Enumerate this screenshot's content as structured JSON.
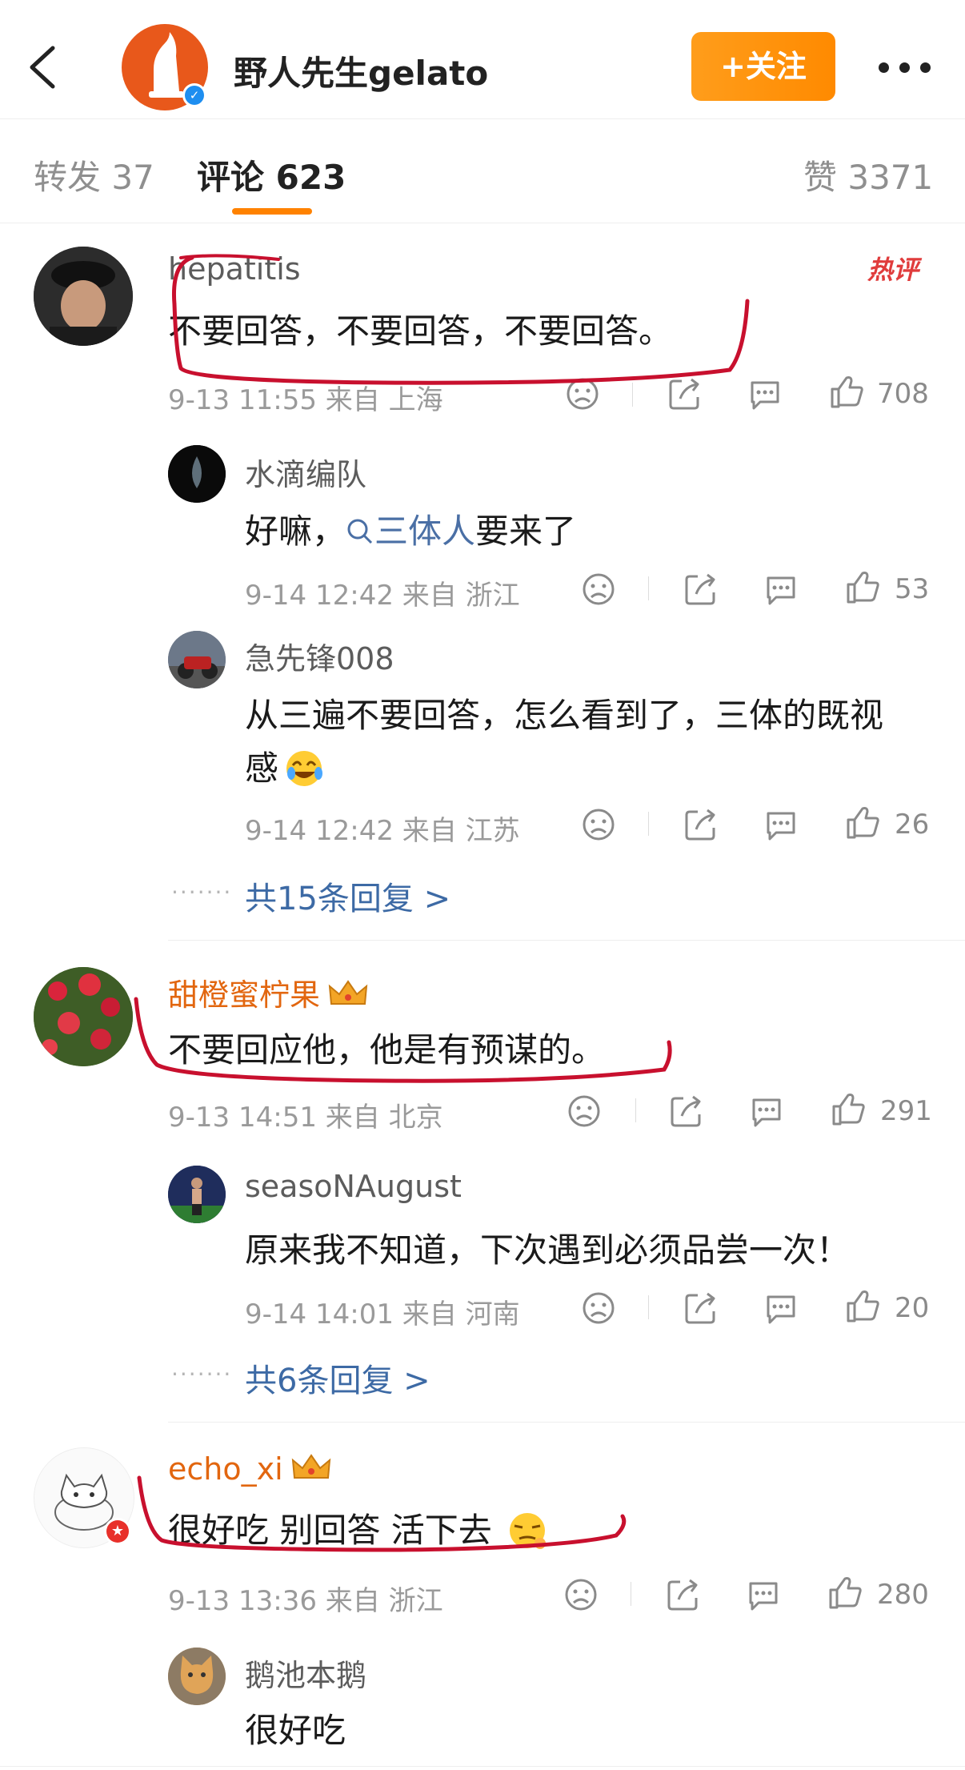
{
  "header": {
    "account_name": "野人先生gelato",
    "follow_label": "+关注"
  },
  "tabs": {
    "repost": "转发 37",
    "comments": "评论 623",
    "likes": "赞 3371"
  },
  "comments": [
    {
      "user": "hepatitis",
      "badge": "热评",
      "text": "不要回答，不要回答，不要回答。",
      "meta": "9-13 11:55 来自 上海",
      "likes": "708",
      "replies": [
        {
          "user": "水滴编队",
          "text_prefix": "好嘛，",
          "topic": "三体人",
          "text_suffix": "要来了",
          "meta": "9-14 12:42 来自 浙江",
          "likes": "53"
        },
        {
          "user": "急先锋008",
          "text_line1": "从三遍不要回答，怎么看到了，三体的既视",
          "text_line2": "感",
          "meta": "9-14 12:42 来自 江苏",
          "likes": "26"
        }
      ],
      "more_replies": "共15条回复 >"
    },
    {
      "user": "甜橙蜜柠果",
      "text": "不要回应他，他是有预谋的。",
      "meta": "9-13 14:51 来自 北京",
      "likes": "291",
      "replies": [
        {
          "user": "seasoNAugust",
          "text": "原来我不知道，下次遇到必须品尝一次！",
          "meta": "9-14 14:01 来自 河南",
          "likes": "20"
        }
      ],
      "more_replies": "共6条回复 >"
    },
    {
      "user": "echo_xi",
      "text": "很好吃  别回答 活下去",
      "meta": "9-13 13:36 来自 浙江",
      "likes": "280",
      "replies": [
        {
          "user": "鹅池本鹅",
          "text": "很好吃"
        }
      ]
    }
  ],
  "colors": {
    "accent": "#ff8200",
    "link": "#3d6aa5",
    "username_vip": "#e2660f",
    "annotation": "#c8102e"
  },
  "icons": [
    "back-arrow-icon",
    "verified-icon",
    "more-icon",
    "dislike-icon",
    "share-icon",
    "comment-icon",
    "like-icon",
    "crown-icon",
    "emoji-icon",
    "search-icon"
  ]
}
